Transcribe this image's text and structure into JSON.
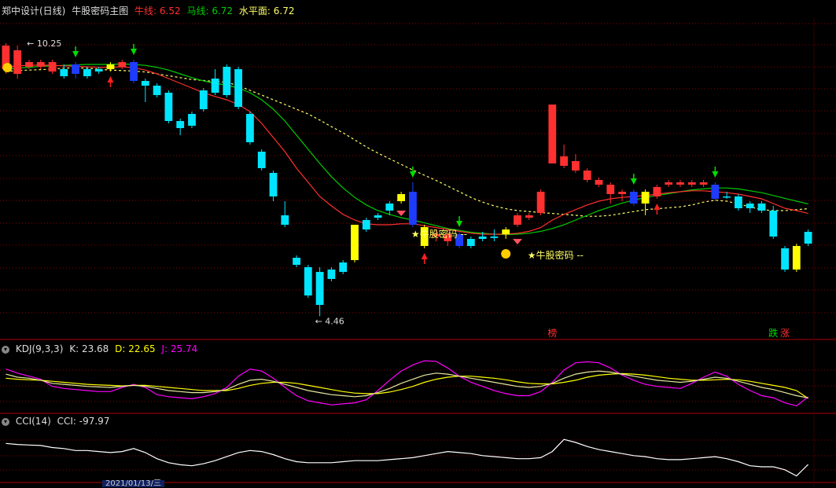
{
  "colors": {
    "up": "#FF3030",
    "down": "#00E5FF",
    "signal_yellow": "#FFFF00",
    "signal_blue": "#1E3CFF",
    "bull_line": "#FF3030",
    "horse_line": "#00CC00",
    "level_line": "#FFFF66",
    "k_line": "#FFFFFF",
    "d_line": "#FFFF00",
    "j_line": "#FF00FF",
    "cci_line": "#FFFFFF",
    "grid": "#8B0000"
  },
  "header": {
    "title": "郑中设计(日线)",
    "indicator_name": "牛股密码主图",
    "bull_label": "牛线:",
    "bull_value": "6.52",
    "horse_label": "马线:",
    "horse_value": "6.72",
    "level_label": "水平面:",
    "level_value": "6.72"
  },
  "kdj": {
    "name": "KDJ(9,3,3)",
    "k_label": "K:",
    "k_value": "23.68",
    "d_label": "D:",
    "d_value": "22.65",
    "j_label": "J:",
    "j_value": "25.74"
  },
  "cci": {
    "name": "CCI(14)",
    "cci_label": "CCI:",
    "cci_value": "-97.97"
  },
  "annotations": {
    "high_label": "10.25",
    "low_label": "4.46",
    "signal_text": "牛股密码",
    "bang": "榜",
    "die": "跌",
    "zhang": "涨"
  },
  "xaxis": {
    "date_label": "2021/01/13/三"
  },
  "chart_data": [
    {
      "type": "candlestick",
      "title": "牛股密码主图",
      "high_marker": 10.25,
      "low_marker": 4.46,
      "ylim": [
        4.0,
        10.8
      ],
      "candles": [
        {
          "o": 9.7,
          "c": 10.2,
          "h": 10.25,
          "l": 9.6,
          "s": "up"
        },
        {
          "o": 9.6,
          "c": 10.1,
          "h": 10.2,
          "l": 9.5,
          "s": "up"
        },
        {
          "o": 9.85,
          "c": 9.75,
          "h": 9.9,
          "l": 9.7,
          "s": "up"
        },
        {
          "o": 9.75,
          "c": 9.85,
          "h": 9.9,
          "l": 9.7,
          "s": "up"
        },
        {
          "o": 9.85,
          "c": 9.65,
          "h": 9.9,
          "l": 9.6,
          "s": "up"
        },
        {
          "o": 9.7,
          "c": 9.55,
          "h": 9.8,
          "l": 9.5,
          "s": "down"
        },
        {
          "o": 9.8,
          "c": 9.6,
          "h": 9.85,
          "l": 9.5,
          "s": "blue"
        },
        {
          "o": 9.7,
          "c": 9.55,
          "h": 9.75,
          "l": 9.5,
          "s": "down"
        },
        {
          "o": 9.65,
          "c": 9.7,
          "h": 9.75,
          "l": 9.6,
          "s": "down"
        },
        {
          "o": 9.7,
          "c": 9.8,
          "h": 9.85,
          "l": 9.65,
          "s": "yellow"
        },
        {
          "o": 9.75,
          "c": 9.85,
          "h": 9.9,
          "l": 9.7,
          "s": "up"
        },
        {
          "o": 9.85,
          "c": 9.45,
          "h": 9.9,
          "l": 9.4,
          "s": "blue"
        },
        {
          "o": 9.45,
          "c": 9.35,
          "h": 9.5,
          "l": 9.0,
          "s": "down"
        },
        {
          "o": 9.15,
          "c": 9.35,
          "h": 9.4,
          "l": 9.1,
          "s": "down"
        },
        {
          "o": 9.2,
          "c": 8.6,
          "h": 9.25,
          "l": 8.55,
          "s": "down"
        },
        {
          "o": 8.6,
          "c": 8.45,
          "h": 8.65,
          "l": 8.3,
          "s": "down"
        },
        {
          "o": 8.75,
          "c": 8.5,
          "h": 8.8,
          "l": 8.45,
          "s": "down"
        },
        {
          "o": 9.25,
          "c": 8.85,
          "h": 9.3,
          "l": 8.8,
          "s": "down"
        },
        {
          "o": 9.5,
          "c": 9.2,
          "h": 9.7,
          "l": 9.15,
          "s": "down"
        },
        {
          "o": 9.75,
          "c": 9.15,
          "h": 9.8,
          "l": 9.1,
          "s": "down"
        },
        {
          "o": 9.7,
          "c": 8.9,
          "h": 9.75,
          "l": 8.85,
          "s": "down"
        },
        {
          "o": 8.75,
          "c": 8.15,
          "h": 8.8,
          "l": 8.1,
          "s": "down"
        },
        {
          "o": 7.95,
          "c": 7.6,
          "h": 8.0,
          "l": 7.55,
          "s": "down"
        },
        {
          "o": 7.5,
          "c": 7.0,
          "h": 7.55,
          "l": 6.9,
          "s": "down"
        },
        {
          "o": 6.6,
          "c": 6.4,
          "h": 6.9,
          "l": 6.35,
          "s": "down"
        },
        {
          "o": 5.7,
          "c": 5.55,
          "h": 5.75,
          "l": 5.5,
          "s": "down"
        },
        {
          "o": 5.5,
          "c": 4.9,
          "h": 5.55,
          "l": 4.85,
          "s": "down"
        },
        {
          "o": 5.4,
          "c": 4.7,
          "h": 5.5,
          "l": 4.46,
          "s": "down"
        },
        {
          "o": 5.45,
          "c": 5.25,
          "h": 5.5,
          "l": 5.2,
          "s": "down"
        },
        {
          "o": 5.6,
          "c": 5.4,
          "h": 5.65,
          "l": 5.35,
          "s": "down"
        },
        {
          "o": 6.4,
          "c": 5.65,
          "h": 6.4,
          "l": 5.6,
          "s": "yellow"
        },
        {
          "o": 6.5,
          "c": 6.3,
          "h": 6.55,
          "l": 6.25,
          "s": "down"
        },
        {
          "o": 6.55,
          "c": 6.6,
          "h": 6.65,
          "l": 6.5,
          "s": "down"
        },
        {
          "o": 6.7,
          "c": 6.85,
          "h": 6.9,
          "l": 6.6,
          "s": "down"
        },
        {
          "o": 6.9,
          "c": 7.05,
          "h": 7.1,
          "l": 6.85,
          "s": "yellow"
        },
        {
          "o": 7.1,
          "c": 6.4,
          "h": 7.3,
          "l": 6.35,
          "s": "blue"
        },
        {
          "o": 6.35,
          "c": 5.95,
          "h": 6.4,
          "l": 5.9,
          "s": "yellow"
        },
        {
          "o": 6.2,
          "c": 6.15,
          "h": 6.3,
          "l": 6.05,
          "s": "up"
        },
        {
          "o": 6.2,
          "c": 6.05,
          "h": 6.3,
          "l": 5.95,
          "s": "up"
        },
        {
          "o": 6.2,
          "c": 5.95,
          "h": 6.25,
          "l": 5.9,
          "s": "blue"
        },
        {
          "o": 6.1,
          "c": 5.95,
          "h": 6.15,
          "l": 5.9,
          "s": "down"
        },
        {
          "o": 6.15,
          "c": 6.1,
          "h": 6.25,
          "l": 6.05,
          "s": "down"
        },
        {
          "o": 6.15,
          "c": 6.12,
          "h": 6.3,
          "l": 6.05,
          "s": "down"
        },
        {
          "o": 6.2,
          "c": 6.3,
          "h": 6.35,
          "l": 6.1,
          "s": "yellow"
        },
        {
          "o": 6.4,
          "c": 6.6,
          "h": 6.65,
          "l": 6.35,
          "s": "up"
        },
        {
          "o": 6.55,
          "c": 6.6,
          "h": 6.65,
          "l": 6.5,
          "s": "up"
        },
        {
          "o": 6.65,
          "c": 7.1,
          "h": 7.15,
          "l": 6.6,
          "s": "up"
        },
        {
          "o": 7.7,
          "c": 8.95,
          "h": 8.95,
          "l": 7.7,
          "s": "up"
        },
        {
          "o": 7.85,
          "c": 7.65,
          "h": 8.1,
          "l": 7.6,
          "s": "up"
        },
        {
          "o": 7.75,
          "c": 7.55,
          "h": 7.9,
          "l": 7.5,
          "s": "up"
        },
        {
          "o": 7.55,
          "c": 7.35,
          "h": 7.6,
          "l": 7.3,
          "s": "up"
        },
        {
          "o": 7.35,
          "c": 7.25,
          "h": 7.4,
          "l": 7.2,
          "s": "up"
        },
        {
          "o": 7.25,
          "c": 7.05,
          "h": 7.3,
          "l": 6.85,
          "s": "up"
        },
        {
          "o": 7.1,
          "c": 7.05,
          "h": 7.15,
          "l": 6.9,
          "s": "up"
        },
        {
          "o": 7.1,
          "c": 6.85,
          "h": 7.15,
          "l": 6.8,
          "s": "blue"
        },
        {
          "o": 6.85,
          "c": 7.1,
          "h": 7.15,
          "l": 6.6,
          "s": "yellow"
        },
        {
          "o": 7.0,
          "c": 7.2,
          "h": 7.25,
          "l": 6.95,
          "s": "up"
        },
        {
          "o": 7.25,
          "c": 7.3,
          "h": 7.35,
          "l": 7.2,
          "s": "up"
        },
        {
          "o": 7.3,
          "c": 7.25,
          "h": 7.35,
          "l": 7.2,
          "s": "up"
        },
        {
          "o": 7.25,
          "c": 7.3,
          "h": 7.35,
          "l": 7.2,
          "s": "up"
        },
        {
          "o": 7.3,
          "c": 7.25,
          "h": 7.35,
          "l": 7.2,
          "s": "up"
        },
        {
          "o": 7.25,
          "c": 6.95,
          "h": 7.3,
          "l": 6.9,
          "s": "blue"
        },
        {
          "o": 7.0,
          "c": 7.0,
          "h": 7.1,
          "l": 6.95,
          "s": "down"
        },
        {
          "o": 7.0,
          "c": 6.75,
          "h": 7.05,
          "l": 6.7,
          "s": "down"
        },
        {
          "o": 6.85,
          "c": 6.75,
          "h": 6.9,
          "l": 6.65,
          "s": "down"
        },
        {
          "o": 6.85,
          "c": 6.7,
          "h": 6.9,
          "l": 6.65,
          "s": "down"
        },
        {
          "o": 6.7,
          "c": 6.15,
          "h": 6.8,
          "l": 6.1,
          "s": "down"
        },
        {
          "o": 5.9,
          "c": 5.45,
          "h": 5.95,
          "l": 5.4,
          "s": "down"
        },
        {
          "o": 5.95,
          "c": 5.45,
          "h": 6.0,
          "l": 5.4,
          "s": "yellow"
        },
        {
          "o": 6.25,
          "c": 6.0,
          "h": 6.3,
          "l": 5.95,
          "s": "down"
        }
      ],
      "ma_bull": [
        9.75,
        9.77,
        9.78,
        9.79,
        9.78,
        9.77,
        9.76,
        9.75,
        9.74,
        9.74,
        9.75,
        9.73,
        9.68,
        9.6,
        9.5,
        9.4,
        9.3,
        9.2,
        9.12,
        9.05,
        8.95,
        8.8,
        8.55,
        8.25,
        7.95,
        7.6,
        7.3,
        7.0,
        6.8,
        6.62,
        6.5,
        6.42,
        6.4,
        6.4,
        6.42,
        6.42,
        6.38,
        6.34,
        6.3,
        6.26,
        6.22,
        6.2,
        6.2,
        6.2,
        6.22,
        6.26,
        6.34,
        6.5,
        6.62,
        6.72,
        6.82,
        6.9,
        6.95,
        6.98,
        7.0,
        7.02,
        7.05,
        7.08,
        7.1,
        7.12,
        7.12,
        7.1,
        7.08,
        7.05,
        7.0,
        6.95,
        6.85,
        6.75,
        6.7,
        6.64
      ],
      "ma_horse": [
        9.7,
        9.72,
        9.74,
        9.76,
        9.77,
        9.78,
        9.79,
        9.8,
        9.8,
        9.8,
        9.81,
        9.8,
        9.78,
        9.74,
        9.68,
        9.6,
        9.52,
        9.45,
        9.4,
        9.36,
        9.3,
        9.2,
        9.05,
        8.85,
        8.6,
        8.3,
        8.0,
        7.7,
        7.42,
        7.18,
        6.98,
        6.82,
        6.7,
        6.62,
        6.55,
        6.5,
        6.44,
        6.38,
        6.32,
        6.28,
        6.24,
        6.22,
        6.2,
        6.19,
        6.2,
        6.22,
        6.26,
        6.32,
        6.4,
        6.5,
        6.6,
        6.7,
        6.78,
        6.86,
        6.92,
        6.98,
        7.02,
        7.06,
        7.1,
        7.14,
        7.16,
        7.18,
        7.18,
        7.16,
        7.12,
        7.08,
        7.02,
        6.96,
        6.9,
        6.84
      ],
      "level": [
        9.65,
        9.67,
        9.68,
        9.69,
        9.7,
        9.72,
        9.73,
        9.72,
        9.7,
        9.68,
        9.67,
        9.66,
        9.64,
        9.6,
        9.56,
        9.52,
        9.48,
        9.46,
        9.44,
        9.42,
        9.35,
        9.25,
        9.15,
        9.05,
        8.95,
        8.85,
        8.75,
        8.62,
        8.48,
        8.35,
        8.2,
        8.05,
        7.92,
        7.8,
        7.68,
        7.56,
        7.45,
        7.34,
        7.22,
        7.1,
        6.98,
        6.88,
        6.8,
        6.74,
        6.7,
        6.68,
        6.66,
        6.64,
        6.62,
        6.6,
        6.58,
        6.58,
        6.6,
        6.64,
        6.68,
        6.72,
        6.74,
        6.76,
        6.78,
        6.82,
        6.88,
        6.92,
        6.9,
        6.84,
        6.78,
        6.72,
        6.7,
        6.7,
        6.72,
        6.74
      ]
    },
    {
      "type": "line",
      "title": "KDJ(9,3,3)",
      "ylim": [
        -5,
        110
      ],
      "series": [
        {
          "name": "K",
          "values": [
            70,
            64,
            62,
            58,
            52,
            50,
            48,
            46,
            45,
            44,
            46,
            48,
            46,
            42,
            38,
            36,
            34,
            34,
            36,
            40,
            50,
            58,
            60,
            56,
            50,
            44,
            38,
            34,
            30,
            28,
            26,
            28,
            34,
            42,
            52,
            60,
            68,
            72,
            70,
            66,
            62,
            58,
            54,
            50,
            46,
            44,
            46,
            52,
            62,
            70,
            74,
            76,
            74,
            70,
            66,
            62,
            58,
            56,
            54,
            56,
            60,
            64,
            62,
            56,
            50,
            44,
            40,
            34,
            28,
            23.68
          ]
        },
        {
          "name": "D",
          "values": [
            62,
            60,
            59,
            58,
            56,
            54,
            52,
            50,
            49,
            48,
            47,
            48,
            48,
            46,
            44,
            42,
            40,
            38,
            38,
            38,
            42,
            48,
            52,
            54,
            54,
            52,
            48,
            44,
            40,
            36,
            33,
            32,
            32,
            35,
            40,
            46,
            54,
            60,
            64,
            66,
            66,
            64,
            62,
            59,
            55,
            52,
            51,
            51,
            54,
            58,
            64,
            68,
            70,
            71,
            70,
            68,
            65,
            62,
            60,
            58,
            58,
            59,
            60,
            59,
            56,
            52,
            48,
            44,
            38,
            22.65
          ]
        },
        {
          "name": "J",
          "values": [
            80,
            72,
            66,
            60,
            46,
            42,
            40,
            38,
            36,
            36,
            44,
            50,
            44,
            30,
            26,
            24,
            22,
            26,
            32,
            44,
            66,
            80,
            76,
            62,
            44,
            28,
            18,
            14,
            10,
            12,
            14,
            20,
            38,
            58,
            76,
            88,
            96,
            95,
            82,
            66,
            54,
            46,
            38,
            32,
            28,
            28,
            36,
            54,
            78,
            92,
            94,
            92,
            82,
            68,
            58,
            50,
            46,
            44,
            42,
            52,
            64,
            74,
            66,
            50,
            38,
            28,
            24,
            14,
            8,
            25.74
          ]
        }
      ]
    },
    {
      "type": "line",
      "title": "CCI(14)",
      "ylim": [
        -260,
        260
      ],
      "series": [
        {
          "name": "CCI",
          "values": [
            110,
            100,
            95,
            90,
            70,
            60,
            40,
            40,
            30,
            20,
            30,
            60,
            20,
            -40,
            -80,
            -100,
            -110,
            -90,
            -60,
            -20,
            20,
            40,
            30,
            0,
            -40,
            -70,
            -80,
            -80,
            -80,
            -70,
            -60,
            -60,
            -60,
            -50,
            -40,
            -30,
            -10,
            10,
            30,
            20,
            10,
            -10,
            -20,
            -30,
            -40,
            -40,
            -30,
            30,
            150,
            120,
            80,
            50,
            30,
            10,
            -10,
            -20,
            -40,
            -50,
            -50,
            -40,
            -30,
            -20,
            -40,
            -70,
            -110,
            -120,
            -120,
            -150,
            -210,
            -97.97
          ]
        }
      ]
    }
  ]
}
